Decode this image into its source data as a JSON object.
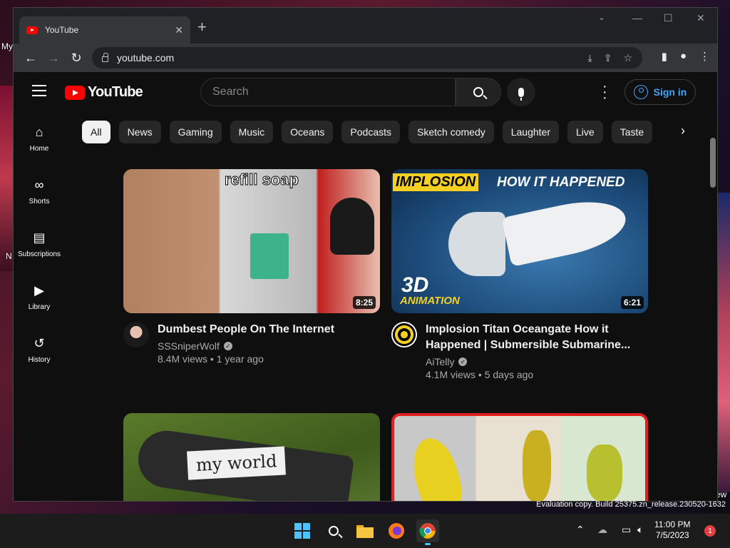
{
  "desktop": {
    "label_my": "My",
    "label_n": "N",
    "label_ew": "ew"
  },
  "browser": {
    "tab_title": "YouTube",
    "url": "youtube.com",
    "new_tab": "+",
    "tab_close": "✕",
    "min": "—",
    "max": "☐",
    "close": "✕"
  },
  "youtube": {
    "logo_text": "YouTube",
    "search_placeholder": "Search",
    "signin_label": "Sign in",
    "sidebar": [
      {
        "label": "Home",
        "icon": "home-icon"
      },
      {
        "label": "Shorts",
        "icon": "shorts-icon"
      },
      {
        "label": "Subscriptions",
        "icon": "subscriptions-icon"
      },
      {
        "label": "Library",
        "icon": "library-icon"
      },
      {
        "label": "History",
        "icon": "history-icon"
      }
    ],
    "chips": [
      "All",
      "News",
      "Gaming",
      "Music",
      "Oceans",
      "Podcasts",
      "Sketch comedy",
      "Laughter",
      "Live",
      "Taste"
    ],
    "videos": [
      {
        "title": "Dumbest People On The Internet",
        "channel": "SSSniperWolf",
        "views": "8.4M views",
        "age": "1 year ago",
        "duration": "8:25",
        "thumb_text": "refill soap"
      },
      {
        "title": "Implosion Titan Oceangate How it Happened | Submersible Submarine...",
        "channel": "AiTelly",
        "views": "4.1M views",
        "age": "5 days ago",
        "duration": "6:21",
        "thumb_text_a": "IMPLOSION",
        "thumb_text_b": "HOW IT HAPPENED",
        "thumb_text_c": "3D",
        "thumb_text_d": "ANIMATION"
      },
      {
        "thumb_text": "my world"
      },
      {
        "thumb_text": ""
      }
    ]
  },
  "watermark": "Evaluation copy. Build 25375.zn_release.230520-1632",
  "taskbar": {
    "time": "11:00 PM",
    "date": "7/5/2023",
    "notifications": "1"
  }
}
